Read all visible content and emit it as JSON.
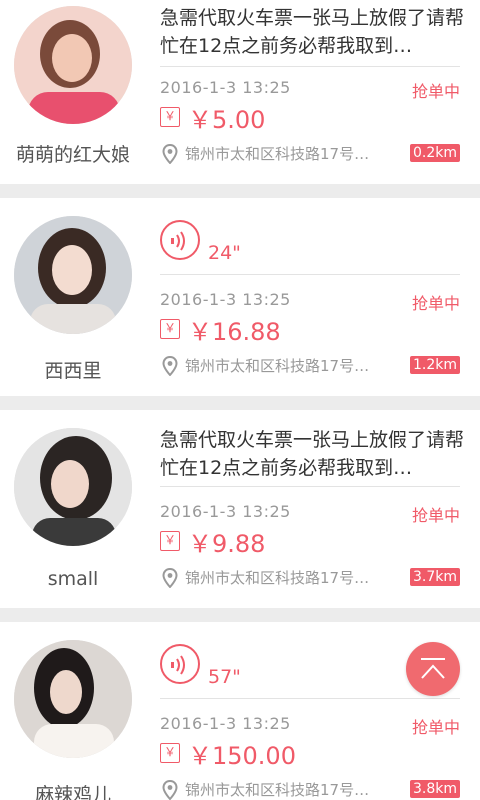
{
  "colors": {
    "accent": "#f05a68",
    "separator": "#ececec",
    "muted": "#999999"
  },
  "orders": [
    {
      "user_name": "萌萌的红大娘",
      "type": "text",
      "description": "急需代取火车票一张马上放假了请帮忙在12点之前务必帮我取到…",
      "time": "2016-1-3  13:25",
      "status": "抢单中",
      "price": "￥5.00",
      "money_icon": "￥",
      "address": "锦州市太和区科技路17号…",
      "distance": "0.2km"
    },
    {
      "user_name": "西西里",
      "type": "voice",
      "voice_duration": "24\"",
      "time": "2016-1-3  13:25",
      "status": "抢单中",
      "price": "￥16.88",
      "money_icon": "￥",
      "address": "锦州市太和区科技路17号…",
      "distance": "1.2km"
    },
    {
      "user_name": "small",
      "type": "text",
      "description": "急需代取火车票一张马上放假了请帮忙在12点之前务必帮我取到…",
      "time": "2016-1-3  13:25",
      "status": "抢单中",
      "price": "￥9.88",
      "money_icon": "￥",
      "address": "锦州市太和区科技路17号…",
      "distance": "3.7km"
    },
    {
      "user_name": "麻辣鸡儿",
      "type": "voice",
      "voice_duration": "57\"",
      "time": "2016-1-3  13:25",
      "status": "抢单中",
      "price": "￥150.00",
      "money_icon": "￥",
      "address": "锦州市太和区科技路17号…",
      "distance": "3.8km"
    }
  ],
  "icons": {
    "voice": "voice-wave-icon",
    "money": "money-packet-icon",
    "location": "location-pin-icon",
    "scroll_top": "chevron-up-icon"
  }
}
